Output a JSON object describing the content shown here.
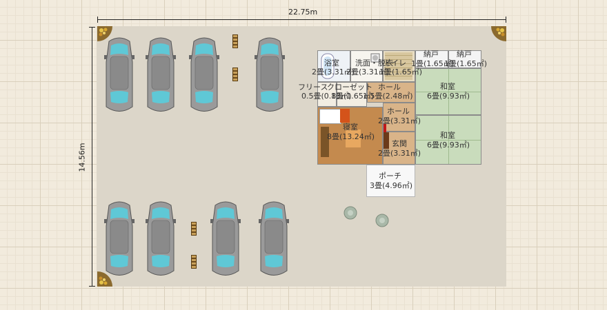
{
  "dimensions": {
    "width_label": "22.75m",
    "height_label": "14.56m"
  },
  "rooms": {
    "bath": {
      "name": "浴室",
      "size": "2畳(3.31㎡)"
    },
    "wash": {
      "name": "洗面・脱衣",
      "size": "2畳(3.31㎡)"
    },
    "toilet": {
      "name": "トイレ",
      "size": "1畳(1.65㎡)"
    },
    "nando1": {
      "name": "納戸",
      "size": "1畳(1.65㎡)"
    },
    "nando2": {
      "name": "納戸",
      "size": "1畳(1.65㎡)"
    },
    "free": {
      "name": "フリース",
      "size": "0.5畳(0.83㎡)"
    },
    "closet": {
      "name": "クローゼット",
      "size": "1畳(1.65㎡)"
    },
    "hall1": {
      "name": "ホール",
      "size": "1.5畳(2.48㎡)"
    },
    "washitsu1": {
      "name": "和室",
      "size": "6畳(9.93㎡)"
    },
    "hall2": {
      "name": "ホール",
      "size": "2畳(3.31㎡)"
    },
    "bedroom": {
      "name": "寝室",
      "size": "8畳(13.24㎡)"
    },
    "washitsu2": {
      "name": "和室",
      "size": "6畳(9.93㎡)"
    },
    "genkan": {
      "name": "玄関",
      "size": "2畳(3.31㎡)"
    },
    "porch": {
      "name": "ポーチ",
      "size": "3畳(4.96㎡)"
    }
  },
  "colors": {
    "car_glass": "#5fc8d6",
    "car_body": "#9a9a9a",
    "tatami": "#c9dcbc",
    "wood_floor": "#c48a4e"
  }
}
